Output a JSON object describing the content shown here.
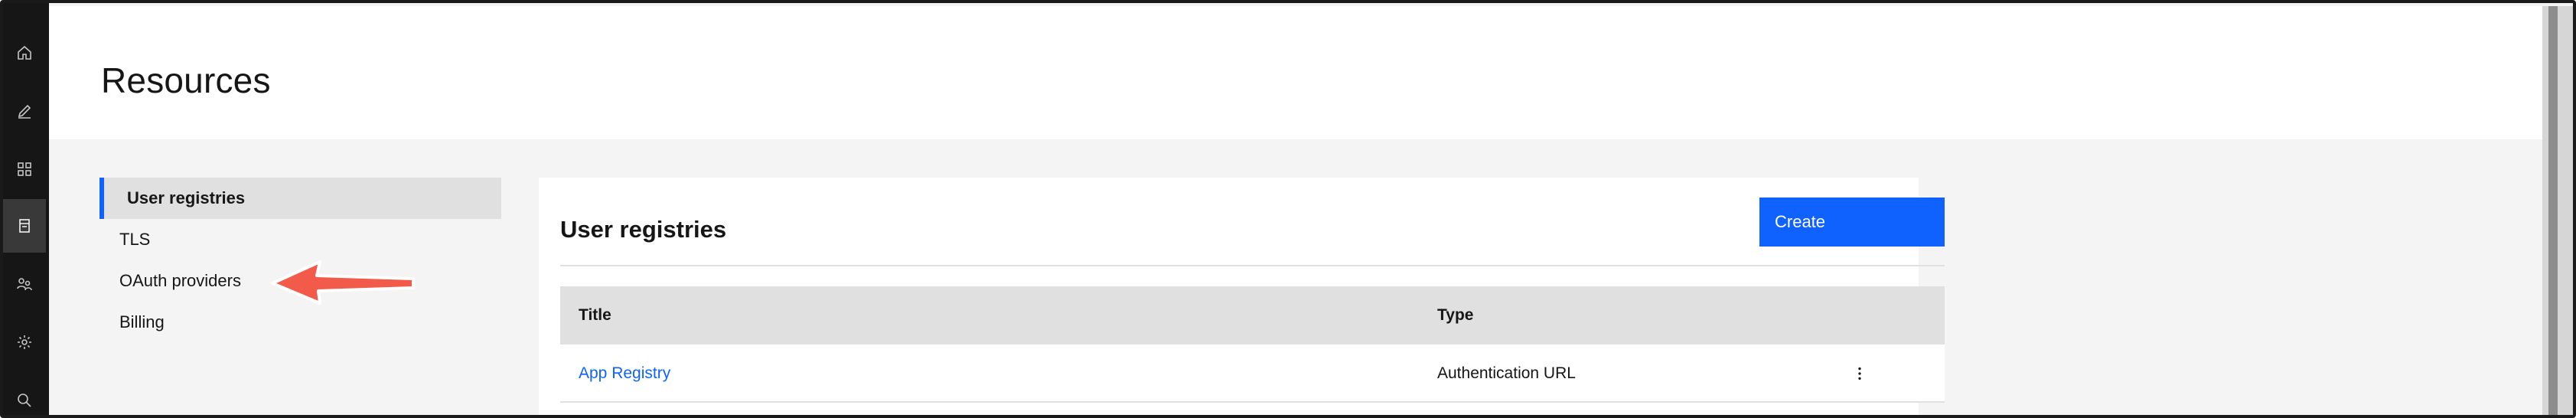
{
  "page": {
    "title": "Resources"
  },
  "rail": {
    "items": [
      {
        "icon": "home-icon"
      },
      {
        "icon": "edit-icon"
      },
      {
        "icon": "apps-grid-icon"
      },
      {
        "icon": "document-icon",
        "active": true
      },
      {
        "icon": "users-icon"
      },
      {
        "icon": "settings-icon"
      },
      {
        "icon": "search-icon"
      }
    ]
  },
  "sidenav": {
    "items": [
      {
        "label": "User registries",
        "active": true
      },
      {
        "label": "TLS"
      },
      {
        "label": "OAuth providers"
      },
      {
        "label": "Billing"
      }
    ]
  },
  "card": {
    "title": "User registries",
    "create_label": "Create",
    "table": {
      "columns": [
        "Title",
        "Type"
      ],
      "rows": [
        {
          "title": "App Registry",
          "type": "Authentication URL"
        }
      ]
    }
  },
  "annotation": {
    "arrow_color": "#f25a4a",
    "points_to": "OAuth providers"
  },
  "colors": {
    "accent": "#0f62fe",
    "rail_bg": "#161616",
    "page_bg": "#f4f4f4"
  }
}
